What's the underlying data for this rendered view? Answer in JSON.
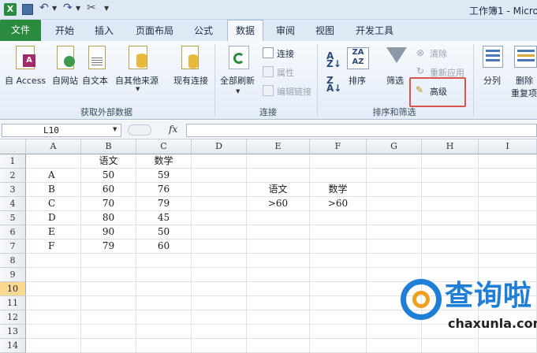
{
  "window": {
    "title": "工作簿1 - Micro"
  },
  "tabs": [
    {
      "label": "文件",
      "kind": "file"
    },
    {
      "label": "开始"
    },
    {
      "label": "插入"
    },
    {
      "label": "页面布局"
    },
    {
      "label": "公式"
    },
    {
      "label": "数据",
      "active": true
    },
    {
      "label": "审阅"
    },
    {
      "label": "视图"
    },
    {
      "label": "开发工具"
    }
  ],
  "ribbon": {
    "groups": {
      "external": "获取外部数据",
      "connections": "连接",
      "sortfilter": "排序和筛选"
    },
    "buttons": {
      "from_access": "自 Access",
      "from_web": "自网站",
      "from_text": "自文本",
      "from_other": "自其他来源",
      "existing_conn": "现有连接",
      "refresh_all": "全部刷新",
      "connections": "连接",
      "properties": "属性",
      "edit_links": "编辑链接",
      "sort": "排序",
      "filter": "筛选",
      "clear": "清除",
      "reapply": "重新应用",
      "advanced": "高级",
      "text_to_columns": "分列",
      "remove_dup_1": "删除",
      "remove_dup_2": "重复项"
    }
  },
  "formula_bar": {
    "name_box": "L10",
    "fx": "fx",
    "value": ""
  },
  "columns": [
    "A",
    "B",
    "C",
    "D",
    "E",
    "F",
    "G",
    "H",
    "I"
  ],
  "rows": [
    "1",
    "2",
    "3",
    "4",
    "5",
    "6",
    "7",
    "8",
    "9",
    "10",
    "11",
    "12",
    "13",
    "14"
  ],
  "selected_row": "10",
  "cells": {
    "B1": "语文",
    "C1": "数学",
    "A2": "A",
    "B2": "50",
    "C2": "59",
    "A3": "B",
    "B3": "60",
    "C3": "76",
    "A4": "C",
    "B4": "70",
    "C4": "79",
    "A5": "D",
    "B5": "80",
    "C5": "45",
    "A6": "E",
    "B6": "90",
    "C6": "50",
    "A7": "F",
    "B7": "79",
    "C7": "60",
    "E3": "语文",
    "F3": "数学",
    "E4": ">60",
    "F4": ">60"
  },
  "watermark": {
    "name": "查询啦",
    "url": "chaxunla.com"
  },
  "colors": {
    "file_tab": "#2a8a3e",
    "highlight": "#d9534f",
    "selected_row": "#f9d98f",
    "watermark": "#1f7fd6"
  }
}
